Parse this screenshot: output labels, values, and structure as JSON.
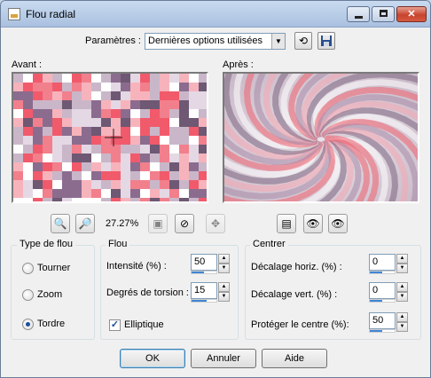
{
  "window": {
    "title": "Flou radial",
    "controls": {
      "minimize": "minimize-icon",
      "maximize": "maximize-icon",
      "close": "close-icon"
    }
  },
  "presets": {
    "label": "Paramètres :",
    "selected": "Dernières options utilisées",
    "reset_icon": "reset-arrow-icon",
    "save_icon": "floppy-disk-icon"
  },
  "previews": {
    "before_label": "Avant :",
    "after_label": "Après :",
    "zoom_level": "27.27%",
    "left_tools": [
      "zoom-out-icon",
      "zoom-in-icon",
      "zoom-fit-icon",
      "reset-zoom-icon",
      "pan-icon"
    ],
    "right_tools": [
      "proof-window-icon",
      "lock-view-icon",
      "auto-proof-icon"
    ]
  },
  "blur_type": {
    "title": "Type de flou",
    "options": [
      {
        "label": "Tourner",
        "selected": false
      },
      {
        "label": "Zoom",
        "selected": false
      },
      {
        "label": "Tordre",
        "selected": true
      }
    ]
  },
  "blur": {
    "title": "Flou",
    "intensity": {
      "label": "Intensité (%) :",
      "value": "50",
      "level_percent": 50
    },
    "twist": {
      "label": "Degrés de torsion :",
      "value": "15",
      "level_percent": 60
    },
    "elliptical": {
      "label": "Elliptique",
      "checked": true
    }
  },
  "center": {
    "title": "Centrer",
    "h_offset": {
      "label": "Décalage horiz. (%) :",
      "value": "0",
      "level_percent": 50
    },
    "v_offset": {
      "label": "Décalage vert. (%) :",
      "value": "0",
      "level_percent": 50
    },
    "protect": {
      "label": "Protéger le centre (%):",
      "value": "50",
      "level_percent": 50
    }
  },
  "buttons": {
    "ok": "OK",
    "cancel": "Annuler",
    "help": "Aide"
  },
  "colors": {
    "accent": "#3f86d6",
    "close_red": "#c7442f",
    "pattern_pink": "#f0606e",
    "pattern_purple": "#8a6f8e"
  }
}
